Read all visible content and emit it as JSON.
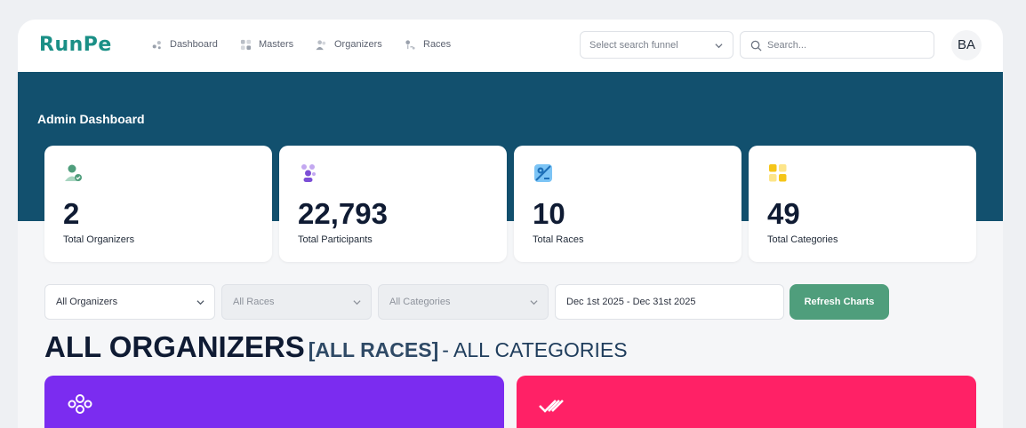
{
  "brand": {
    "logo": "RunPe"
  },
  "nav": [
    {
      "label": "Dashboard",
      "icon": "dashboard-icon"
    },
    {
      "label": "Masters",
      "icon": "masters-icon"
    },
    {
      "label": "Organizers",
      "icon": "organizers-icon"
    },
    {
      "label": "Races",
      "icon": "races-icon"
    }
  ],
  "header": {
    "funnel_placeholder": "Select search funnel",
    "search_placeholder": "Search...",
    "avatar_initials": "BA"
  },
  "dashboard": {
    "title": "Admin Dashboard"
  },
  "stats": [
    {
      "value": "2",
      "label": "Total Organizers",
      "icon": "organizer-check-icon",
      "color": "#4f9e7c"
    },
    {
      "value": "22,793",
      "label": "Total Participants",
      "icon": "participants-icon",
      "color": "#7c4fd6"
    },
    {
      "value": "10",
      "label": "Total Races",
      "icon": "map-pin-icon",
      "color": "#3b9be0"
    },
    {
      "value": "49",
      "label": "Total Categories",
      "icon": "categories-grid-icon",
      "color": "#f5c518"
    }
  ],
  "filters": {
    "organizers": "All Organizers",
    "races": "All Races",
    "categories": "All Categories",
    "date_range": "Dec 1st 2025 - Dec 31st 2025",
    "refresh_label": "Refresh Charts"
  },
  "section_heading": {
    "main": "ALL ORGANIZERS",
    "races": "[ALL RACES]",
    "categories": "- ALL CATEGORIES"
  },
  "colors": {
    "hero": "#12506e",
    "accent": "#1a8f86",
    "refresh_button": "#4f9e7c",
    "card_purple": "#7b2cf0",
    "card_pink": "#ff2166"
  }
}
